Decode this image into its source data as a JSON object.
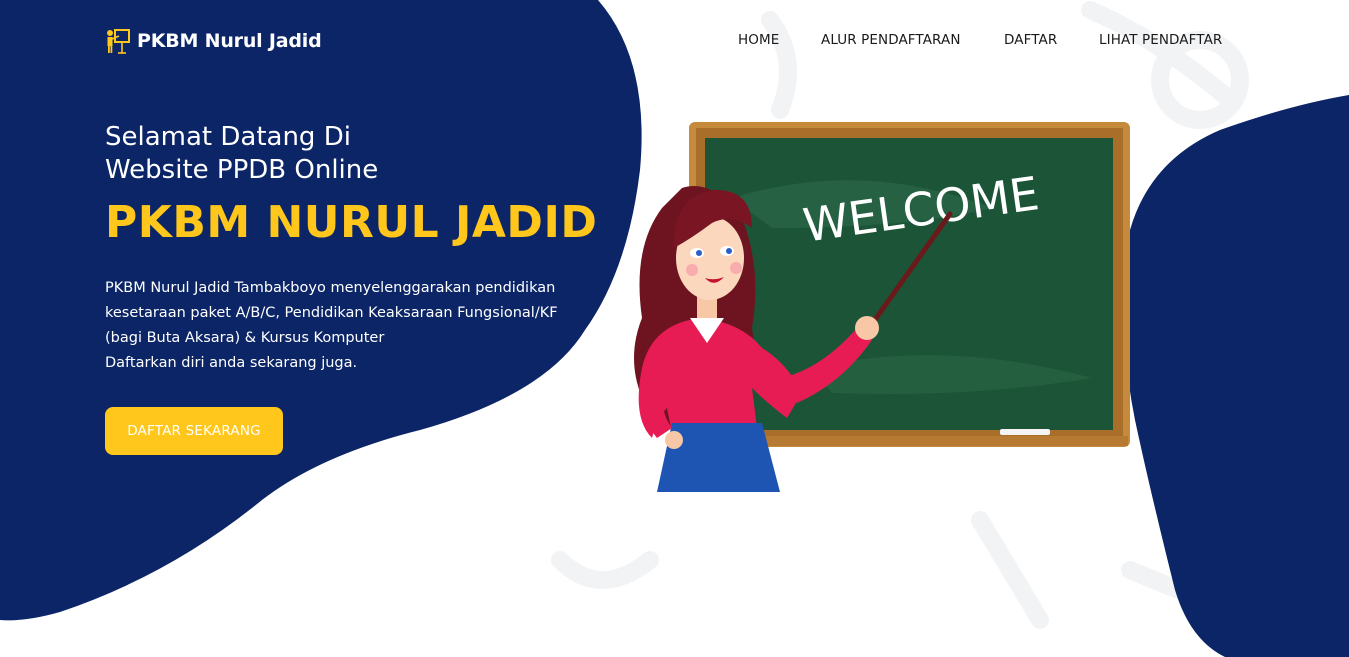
{
  "brand": {
    "name": "PKBM Nurul Jadid",
    "icon": "teacher-board-icon"
  },
  "nav": {
    "items": [
      {
        "label": "HOME"
      },
      {
        "label": "ALUR PENDAFTARAN"
      },
      {
        "label": "DAFTAR"
      },
      {
        "label": "LIHAT PENDAFTAR"
      }
    ]
  },
  "hero": {
    "subtitle_line1": "Selamat Datang Di",
    "subtitle_line2": "Website PPDB Online",
    "title": "PKBM NURUL JADID",
    "description_lines": [
      "PKBM Nurul Jadid Tambakboyo menyelenggarakan pendidikan",
      "kesetaraan paket A/B/C, Pendidikan Keaksaraan Fungsional/KF",
      "(bagi Buta Aksara) & Kursus Komputer",
      "Daftarkan diri anda sekarang juga."
    ],
    "cta_label": "DAFTAR SEKARANG"
  },
  "illustration": {
    "board_text": "WELCOME"
  },
  "colors": {
    "navy": "#0c2566",
    "accent": "#ffc61b",
    "white": "#ffffff"
  }
}
